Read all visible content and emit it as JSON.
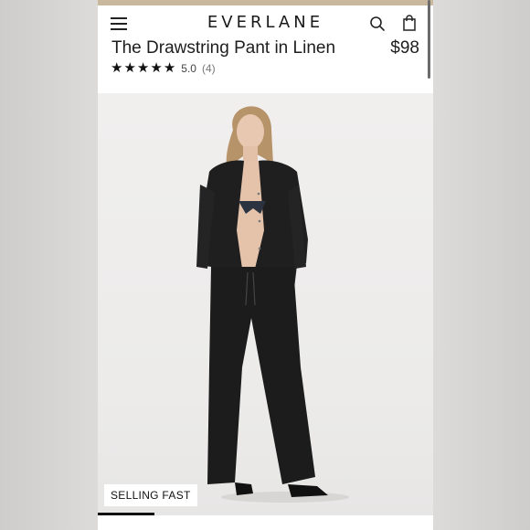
{
  "header": {
    "brand": "EVERLANE"
  },
  "product": {
    "title": "The Drawstring Pant in Linen",
    "price": "$98",
    "rating_value": "5.0",
    "rating_count": "(4)",
    "stars": 5
  },
  "gallery": {
    "badge": "SELLING FAST",
    "progress_fraction": 0.17
  },
  "colors": {
    "accent_strip": "#c9b89e",
    "text": "#1e1e1e"
  },
  "icons": {
    "menu": "hamburger-icon",
    "search": "search-icon",
    "bag": "shopping-bag-icon",
    "star": "star-icon"
  }
}
